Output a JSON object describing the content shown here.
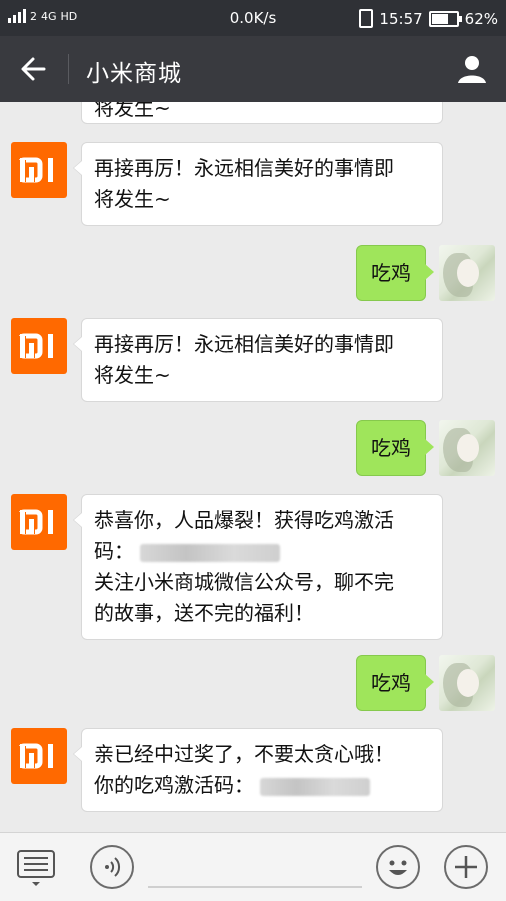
{
  "status_bar": {
    "signal_sub": "2",
    "network": "4G",
    "hd": "HD",
    "speed": "0.0K/s",
    "time": "15:57",
    "battery": "62%",
    "battery_level": 0.62
  },
  "header": {
    "title": "小米商城",
    "back_icon": "arrow-left-icon",
    "profile_icon": "user-icon"
  },
  "messages": [
    {
      "side": "left",
      "lines": [
        "将发生~"
      ]
    },
    {
      "side": "left",
      "lines": [
        "再接再厉！永远相信美好的事情即",
        "将发生~"
      ]
    },
    {
      "side": "right",
      "text": "吃鸡"
    },
    {
      "side": "left",
      "lines": [
        "再接再厉！永远相信美好的事情即",
        "将发生~"
      ]
    },
    {
      "side": "right",
      "text": "吃鸡"
    },
    {
      "side": "left",
      "lines": [
        "恭喜你，人品爆裂！获得吃鸡激活",
        "码：",
        "关注小米商城微信公众号，聊不完",
        "的故事，送不完的福利！"
      ]
    },
    {
      "side": "right",
      "text": "吃鸡"
    },
    {
      "side": "left",
      "lines": [
        "亲已经中过奖了，不要太贪心哦！",
        "你的吃鸡激活码："
      ]
    }
  ],
  "bottom_bar": {
    "menu_icon": "menu-icon",
    "voice_icon": "voice-icon",
    "emoji_icon": "emoji-icon",
    "plus_icon": "plus-icon"
  },
  "colors": {
    "status_bg": "#2f3136",
    "header_bg": "#393a3f",
    "chat_bg": "#ebebeb",
    "my_bubble": "#9fe55b",
    "mi_orange": "#ff6900"
  }
}
